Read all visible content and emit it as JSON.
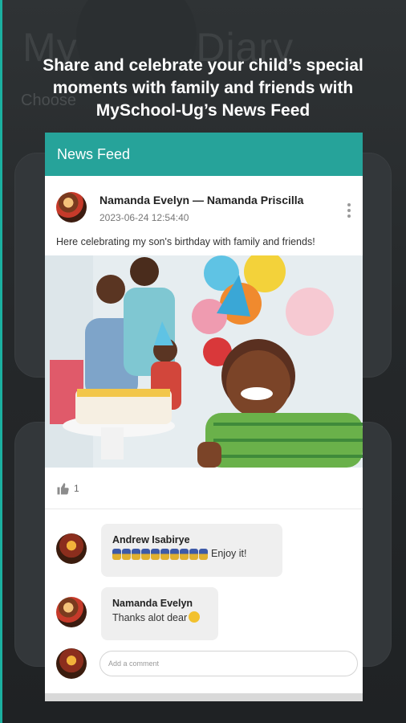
{
  "background": {
    "app_title": "My Baby Diary",
    "app_subtitle": "Choose"
  },
  "headline": "Share and celebrate your child’s special moments with family and friends with MySchool-Ug’s News Feed",
  "appbar": {
    "title": "News Feed"
  },
  "post": {
    "author": "Namanda Evelyn — Namanda Priscilla",
    "timestamp": "2023-06-24 12:54:40",
    "text": "Here celebrating my son's birthday with family and friends!",
    "like_count": "1"
  },
  "comments": [
    {
      "author": "Andrew Isabirye",
      "text": "Enjoy it!",
      "emoji_count": 10
    },
    {
      "author": "Namanda Evelyn",
      "text": "Thanks alot dear"
    }
  ],
  "comment_input": {
    "placeholder": "Add a comment"
  },
  "colors": {
    "accent": "#26a39a",
    "background": "#2a2d30"
  }
}
